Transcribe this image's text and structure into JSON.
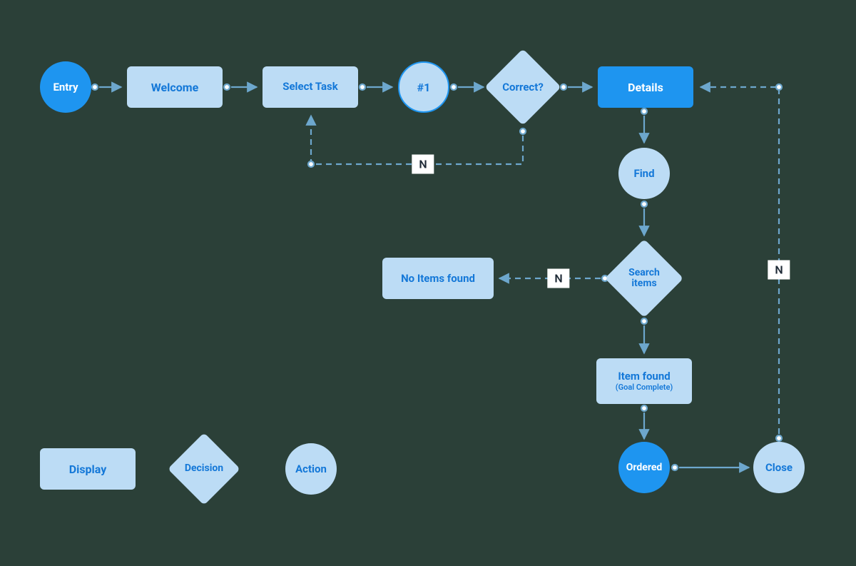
{
  "colors": {
    "light": "#bcdcf5",
    "accent": "#1e95f0",
    "text": "#1478d8",
    "bg": "#2b4038",
    "stroke": "#6da7cd"
  },
  "nodes": {
    "entry": "Entry",
    "welcome": "Welcome",
    "select_task": "Select Task",
    "num1": "#1",
    "correct": "Correct?",
    "details": "Details",
    "find": "Find",
    "search_items": "Search items",
    "no_items": "No Items found",
    "item_found": "Item found",
    "item_found_sub": "(Goal Complete)",
    "ordered": "Ordered",
    "close": "Close"
  },
  "edge_labels": {
    "correct_no": "N",
    "search_no": "N",
    "close_no": "N"
  },
  "legend": {
    "display": "Display",
    "decision": "Decision",
    "action": "Action"
  }
}
